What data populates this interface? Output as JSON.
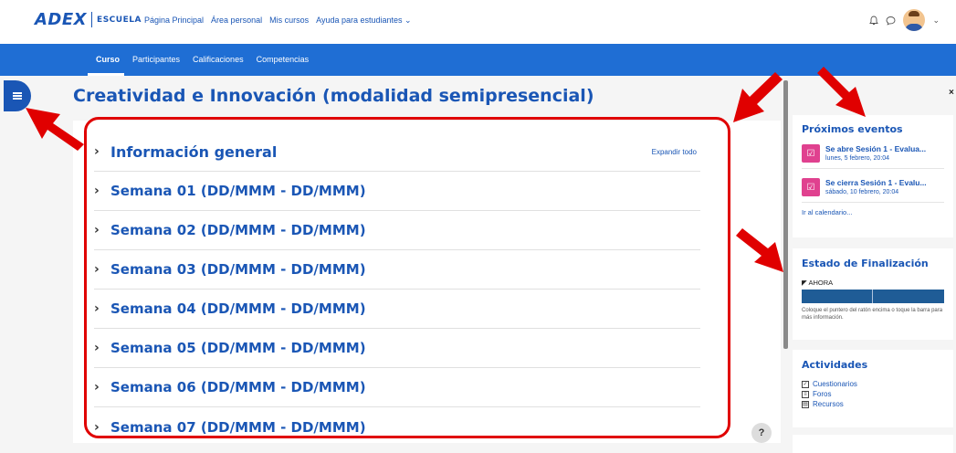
{
  "header": {
    "logo_main": "ADEX",
    "logo_sub": "ESCUELA",
    "nav": [
      "Página Principal",
      "Área personal",
      "Mis cursos",
      "Ayuda para estudiantes ⌄"
    ],
    "bell_icon": "bell-icon",
    "chat_icon": "chat-icon",
    "avatar_caret": "⌄"
  },
  "tabs": [
    "Curso",
    "Participantes",
    "Calificaciones",
    "Competencias"
  ],
  "course": {
    "title": "Creatividad e Innovación (modalidad semipresencial)",
    "expand_all": "Expandir todo",
    "sections": [
      "Información general",
      "Semana 01 (DD/MMM - DD/MMM)",
      "Semana 02 (DD/MMM - DD/MMM)",
      "Semana 03 (DD/MMM - DD/MMM)",
      "Semana 04 (DD/MMM - DD/MMM)",
      "Semana 05 (DD/MMM - DD/MMM)",
      "Semana 06 (DD/MMM - DD/MMM)",
      "Semana 07 (DD/MMM - DD/MMM)"
    ]
  },
  "blocks": {
    "events": {
      "title": "Próximos eventos",
      "items": [
        {
          "title": "Se abre Sesión 1 - Evalua...",
          "date": "lunes, 5 febrero, 20:04"
        },
        {
          "title": "Se cierra Sesión 1 - Evalu...",
          "date": "sábado, 10 febrero, 20:04"
        }
      ],
      "calendar_link": "Ir al calendario..."
    },
    "completion": {
      "title": "Estado de Finalización",
      "now_label": "AHORA",
      "hint": "Coloque el puntero del ratón encima o toque la barra para más información."
    },
    "activities": {
      "title": "Actividades",
      "items": [
        "Cuestionarios",
        "Foros",
        "Recursos"
      ]
    }
  },
  "help_label": "?",
  "close_label": "×",
  "colors": {
    "brand": "#1a56b5",
    "bar": "#1f6ed4",
    "annotation": "#e00000",
    "event": "#e0418f"
  }
}
